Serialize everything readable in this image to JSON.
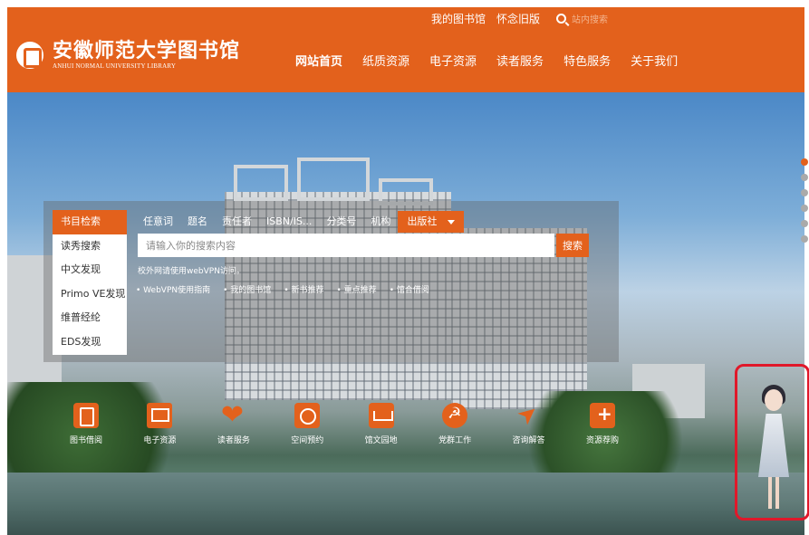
{
  "header": {
    "logo_cn": "安徽师范大学图书馆",
    "logo_en": "ANHUI NORMAL UNIVERSITY LIBRARY",
    "top_links": [
      "我的图书馆",
      "怀念旧版"
    ],
    "search_placeholder": "站内搜索",
    "nav": [
      "网站首页",
      "纸质资源",
      "电子资源",
      "读者服务",
      "特色服务",
      "关于我们"
    ]
  },
  "search_panel": {
    "sidebar": [
      "书目检索",
      "读秀搜索",
      "中文发现",
      "Primo VE发现",
      "维普经纶",
      "EDS发现"
    ],
    "tabs": [
      "任意词",
      "题名",
      "责任者",
      "ISBN/IS...",
      "分类号",
      "机构",
      "出版社"
    ],
    "input_placeholder": "请输入你的搜索内容",
    "search_button": "搜索",
    "vpn_note": "校外网请使用webVPN访问。",
    "quick_links": [
      "WebVPN使用指南",
      "我的图书馆",
      "新书推荐",
      "重点推荐",
      "馆合借阅"
    ]
  },
  "services": [
    "图书借阅",
    "电子资源",
    "读者服务",
    "空间预约",
    "馆文园地",
    "党群工作",
    "咨询解答",
    "资源荐购"
  ],
  "colors": {
    "brand": "#e3611c",
    "assistant_border": "#e0182a"
  }
}
